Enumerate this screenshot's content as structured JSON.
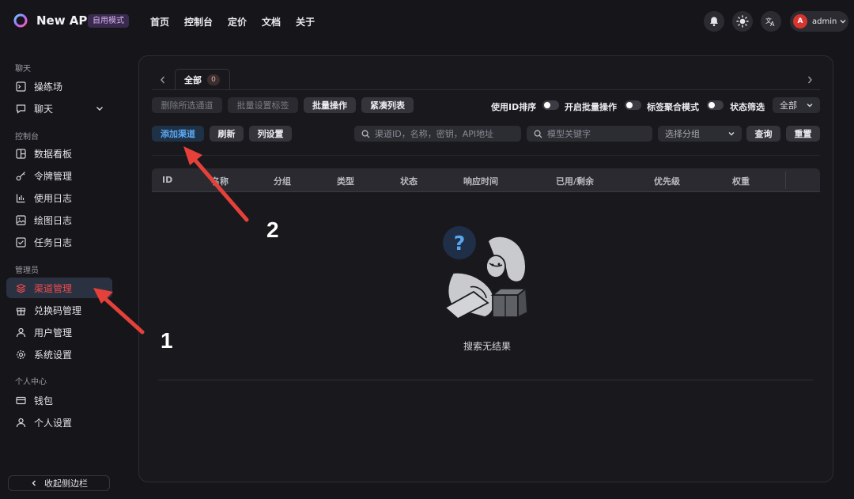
{
  "header": {
    "brand": "New API",
    "badge": "自用模式",
    "nav": [
      "首页",
      "控制台",
      "定价",
      "文档",
      "关于"
    ],
    "icons": [
      "bell-icon",
      "sun-icon",
      "translate-icon"
    ],
    "user": {
      "avatar_letter": "A",
      "name": "admin"
    }
  },
  "sidebar": {
    "sections": [
      {
        "title": "聊天",
        "items": [
          {
            "label": "操练场",
            "icon": "terminal-icon"
          },
          {
            "label": "聊天",
            "icon": "chat-icon"
          }
        ]
      },
      {
        "title": "控制台",
        "items": [
          {
            "label": "数据看板",
            "icon": "dashboard-icon"
          },
          {
            "label": "令牌管理",
            "icon": "key-icon"
          },
          {
            "label": "使用日志",
            "icon": "bar-chart-icon"
          },
          {
            "label": "绘图日志",
            "icon": "image-icon"
          },
          {
            "label": "任务日志",
            "icon": "checklist-icon"
          }
        ]
      },
      {
        "title": "管理员",
        "items": [
          {
            "label": "渠道管理",
            "icon": "layers-icon",
            "active": true
          },
          {
            "label": "兑换码管理",
            "icon": "gift-icon"
          },
          {
            "label": "用户管理",
            "icon": "user-icon"
          },
          {
            "label": "系统设置",
            "icon": "gear-icon"
          }
        ]
      },
      {
        "title": "个人中心",
        "items": [
          {
            "label": "钱包",
            "icon": "wallet-icon"
          },
          {
            "label": "个人设置",
            "icon": "user-icon"
          }
        ]
      }
    ],
    "collapse_label": "收起侧边栏"
  },
  "tabs": {
    "all_label": "全部",
    "all_count": "0"
  },
  "toolbar": {
    "delete_selected": "删除所选通道",
    "batch_tag": "批量设置标签",
    "batch_ops": "批量操作",
    "compact_list": "紧凑列表",
    "sort_by_id": "使用ID排序",
    "enable_batch": "开启批量操作",
    "tag_aggregate": "标签聚合模式",
    "status_filter": "状态筛选",
    "status_value": "全部",
    "add_channel": "添加渠道",
    "refresh": "刷新",
    "column_settings": "列设置",
    "search_placeholder": "渠道ID，名称，密钥，API地址",
    "model_placeholder": "模型关键字",
    "group_placeholder": "选择分组",
    "query": "查询",
    "reset": "重置"
  },
  "table": {
    "columns": [
      "ID",
      "名称",
      "分组",
      "类型",
      "状态",
      "响应时间",
      "已用/剩余",
      "优先级",
      "权重"
    ],
    "empty_text": "搜索无结果"
  },
  "annotations": [
    "1",
    "2"
  ],
  "colors": {
    "accent_red": "#ef4a4a",
    "primary_blue": "#5aa7f0",
    "arrow_red": "#e5403a"
  }
}
